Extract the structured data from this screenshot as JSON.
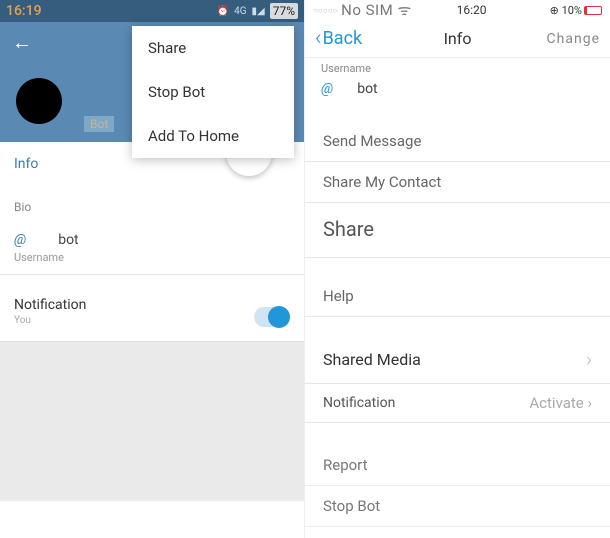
{
  "left": {
    "status": {
      "time": "16:19",
      "signal": "4G",
      "battery": "77%"
    },
    "header": {
      "bot_tag": "Bot"
    },
    "menu": {
      "share": "Share",
      "stop_bot": "Stop Bot",
      "add_home": "Add To Home"
    },
    "info_label": "Info",
    "bio_label": "Bio",
    "username": {
      "at": "@",
      "value": "bot",
      "caption": "Username"
    },
    "notification": {
      "title": "Notification",
      "sub": "You"
    }
  },
  "right": {
    "status": {
      "nosim": "No SIM",
      "time": "16:20",
      "battery": "10%"
    },
    "nav": {
      "back": "Back",
      "title": "Info",
      "change": "Change"
    },
    "username": {
      "label": "Username",
      "at": "@",
      "value": "bot"
    },
    "items": {
      "send_message": "Send Message",
      "share_contact": "Share My Contact",
      "share": "Share",
      "help": "Help",
      "shared_media": "Shared Media",
      "notification": "Notification",
      "activate": "Activate",
      "report": "Report",
      "stop_bot": "Stop Bot"
    }
  }
}
